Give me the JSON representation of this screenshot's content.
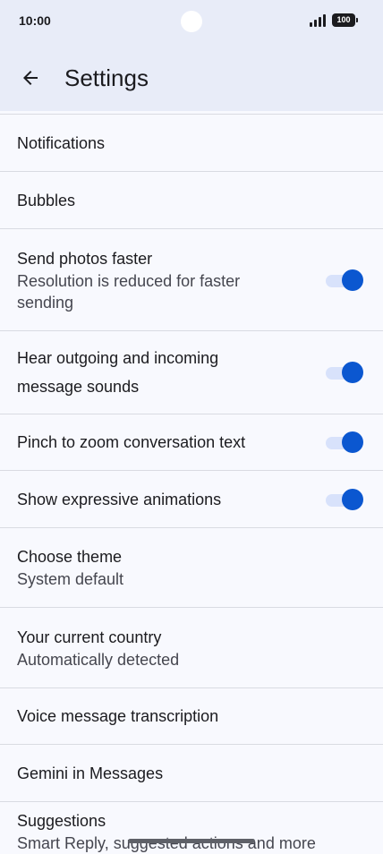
{
  "status": {
    "time": "10:00",
    "battery": "100"
  },
  "header": {
    "title": "Settings"
  },
  "items": [
    {
      "title": "Notifications",
      "subtitle": ""
    },
    {
      "title": "Bubbles",
      "subtitle": ""
    },
    {
      "title": "Send photos faster",
      "subtitle": "Resolution is reduced for faster sending",
      "toggle": "on"
    },
    {
      "title": "Hear outgoing and incoming message sounds",
      "subtitle": "",
      "toggle": "on"
    },
    {
      "title": "Pinch to zoom conversation text",
      "subtitle": "",
      "toggle": "on"
    },
    {
      "title": "Show expressive animations",
      "subtitle": "",
      "toggle": "on"
    },
    {
      "title": "Choose theme",
      "subtitle": "System default"
    },
    {
      "title": "Your current country",
      "subtitle": "Automatically detected"
    },
    {
      "title": "Voice message transcription",
      "subtitle": ""
    },
    {
      "title": "Gemini in Messages",
      "subtitle": ""
    },
    {
      "title": "Suggestions",
      "subtitle": "Smart Reply, suggested actions and more"
    }
  ],
  "colors": {
    "accent": "#0b57d0",
    "toggle_track": "#d8e2fb",
    "header_bg": "#e8ecf8",
    "page_bg": "#f8f9fe"
  }
}
